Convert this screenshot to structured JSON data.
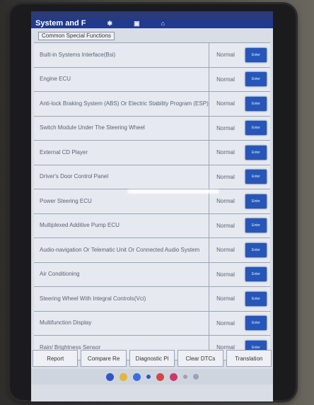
{
  "header": {
    "title": "System and F"
  },
  "section": {
    "label": "Common Special Functions"
  },
  "rows": [
    {
      "name": "Built-in Systems Interface(Bsi)",
      "status": "Normal",
      "button": "Enter"
    },
    {
      "name": "Engine ECU",
      "status": "Normal",
      "button": "Enter"
    },
    {
      "name": "Anti-lock Braking System (ABS) Or Electric Stability Program (ESP)",
      "status": "Normal",
      "button": "Enter"
    },
    {
      "name": "Switch Module Under The Steering Wheel",
      "status": "Normal",
      "button": "Enter"
    },
    {
      "name": "External CD Player",
      "status": "Normal",
      "button": "Enter"
    },
    {
      "name": "Driver's Door Control Panel",
      "status": "Normal",
      "button": "Enter"
    },
    {
      "name": "Power Steering ECU",
      "status": "Normal",
      "button": "Enter"
    },
    {
      "name": "Multiplexed Additive Pump ECU",
      "status": "Normal",
      "button": "Enter"
    },
    {
      "name": "Audio-navigation Or Telematic Unit Or Connected Audio System",
      "status": "Normal",
      "button": "Enter"
    },
    {
      "name": "Air Conditioning",
      "status": "Normal",
      "button": "Enter"
    },
    {
      "name": "Steering Wheel With Integral Controls(Vci)",
      "status": "Normal",
      "button": "Enter"
    },
    {
      "name": "Multifunction Display",
      "status": "Normal",
      "button": "Enter"
    },
    {
      "name": "Rain/ Brightness Sensor",
      "status": "Normal",
      "button": "Enter"
    }
  ],
  "bottom_buttons": {
    "report": "Report",
    "compare": "Compare Re",
    "diagnostic": "Diagnostic Pl",
    "clear": "Clear DTCs",
    "translation": "Translation"
  },
  "colors": {
    "titlebar": "#213a8c",
    "enter_button": "#2656b8"
  }
}
